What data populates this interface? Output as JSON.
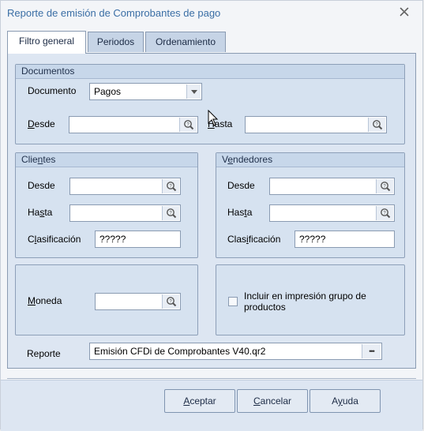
{
  "window": {
    "title": "Reporte de emisión de Comprobantes de pago",
    "close_icon": "close-icon"
  },
  "tabs": [
    {
      "label": "Filtro general",
      "active": true
    },
    {
      "label": "Periodos",
      "active": false
    },
    {
      "label": "Ordenamiento",
      "active": false
    }
  ],
  "documentos": {
    "title": "Documentos",
    "documento_label": "Documento",
    "documento_value": "Pagos",
    "desde_label_u": "D",
    "desde_label_rest": "esde",
    "desde_value": "",
    "hasta_label_u": "H",
    "hasta_label_rest": "asta",
    "hasta_value": ""
  },
  "clientes": {
    "title_pre": "Clie",
    "title_u": "n",
    "title_post": "tes",
    "desde_label": "Desde",
    "desde_value": "",
    "hasta_label_pre": "Ha",
    "hasta_label_u": "s",
    "hasta_label_post": "ta",
    "hasta_value": "",
    "clasificacion_label_pre": "C",
    "clasificacion_label_u": "l",
    "clasificacion_label_post": "asificación",
    "clasificacion_value": "?????"
  },
  "vendedores": {
    "title_pre": "V",
    "title_u": "e",
    "title_post": "ndedores",
    "desde_label": "Desde",
    "desde_value": "",
    "hasta_label_pre": "Has",
    "hasta_label_u": "t",
    "hasta_label_post": "a",
    "hasta_value": "",
    "clasificacion_label_pre": "Clas",
    "clasificacion_label_u": "i",
    "clasificacion_label_post": "ficación",
    "clasificacion_value": "?????"
  },
  "moneda": {
    "label_u": "M",
    "label_rest": "oneda",
    "value": ""
  },
  "incluir": {
    "label": "Incluir en impresión grupo de productos",
    "checked": false
  },
  "reporte": {
    "label": "Reporte",
    "value": "Emisión CFDi de Comprobantes V40.qr2",
    "browse": "•••"
  },
  "buttons": {
    "aceptar_u": "A",
    "aceptar_rest": "ceptar",
    "cancelar_u": "C",
    "cancelar_rest": "ancelar",
    "ayuda_pre": "A",
    "ayuda_u": "y",
    "ayuda_post": "uda"
  }
}
